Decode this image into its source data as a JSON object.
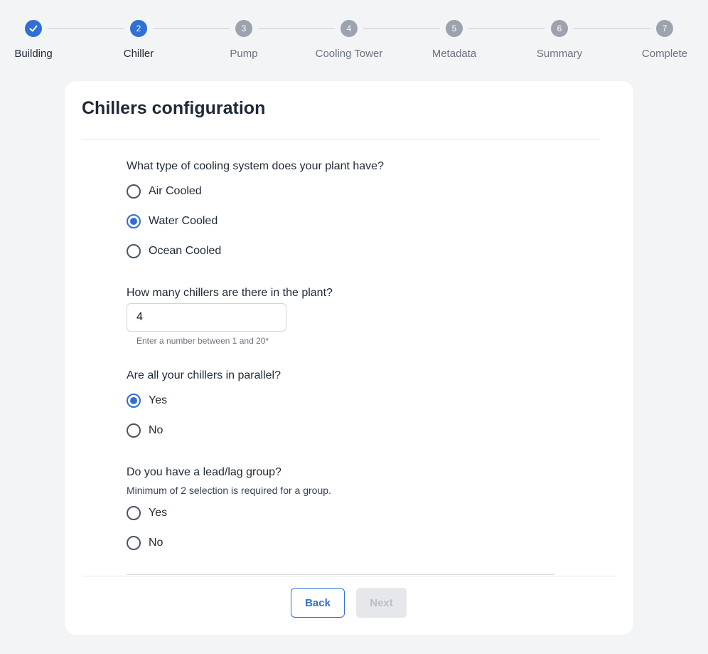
{
  "stepper": {
    "steps": [
      {
        "number": "1",
        "label": "Building",
        "state": "done"
      },
      {
        "number": "2",
        "label": "Chiller",
        "state": "active"
      },
      {
        "number": "3",
        "label": "Pump",
        "state": "pending"
      },
      {
        "number": "4",
        "label": "Cooling Tower",
        "state": "pending"
      },
      {
        "number": "5",
        "label": "Metadata",
        "state": "pending"
      },
      {
        "number": "6",
        "label": "Summary",
        "state": "pending"
      },
      {
        "number": "7",
        "label": "Complete",
        "state": "pending"
      }
    ],
    "done_icon": "check-icon"
  },
  "card": {
    "title": "Chillers configuration"
  },
  "cooling_system": {
    "question": "What type of cooling system does your plant have?",
    "options": [
      "Air Cooled",
      "Water Cooled",
      "Ocean Cooled"
    ],
    "selected": "Water Cooled"
  },
  "chiller_count": {
    "question": "How many chillers are there in the plant?",
    "value": "4",
    "helper": "Enter a number between 1 and 20*"
  },
  "parallel": {
    "question": "Are all your chillers in parallel?",
    "options": [
      "Yes",
      "No"
    ],
    "selected": "Yes"
  },
  "lead_lag": {
    "question": "Do you have a lead/lag group?",
    "subtext": "Minimum of 2 selection is required for a group.",
    "options": [
      "Yes",
      "No"
    ],
    "selected": null
  },
  "buttons": {
    "back": "Back",
    "next": "Next"
  },
  "colors": {
    "accent": "#2f6fd6",
    "pending": "#9ca3af",
    "disabled_bg": "#e5e7eb"
  }
}
